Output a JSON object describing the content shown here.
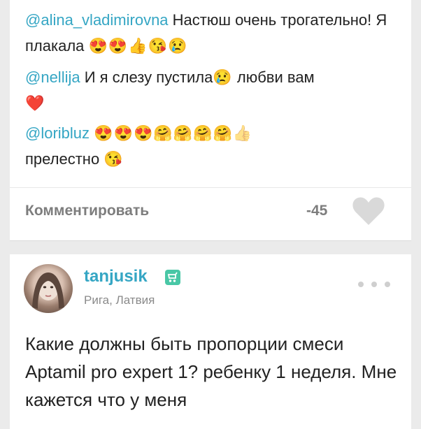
{
  "comments": [
    {
      "user": "@alina_vladimirovna",
      "text": "Настюш  очень трогательно!  Я плакала",
      "emojis": "😍😍👍😘😢"
    },
    {
      "user": "@nellija",
      "text": "И я слезу пустила",
      "emoji_inline": "😢",
      "text_after": "любви вам",
      "emojis": "❤️"
    },
    {
      "user": "@loribluz",
      "emojis": "😍😍😍🤗🤗🤗🤗",
      "emoji_end": "👍",
      "text": "прелестно",
      "emoji_tail": "😘"
    }
  ],
  "actions": {
    "comment_label": "Комментировать",
    "likes_count": "-45"
  },
  "post": {
    "username": "tanjusik",
    "location": "Рига, Латвия",
    "text": "Какие должны быть пропорции смеси Aptamil pro expert 1? ребенку 1 неделя. Мне кажется что у меня"
  },
  "colors": {
    "accent": "#35a6c4",
    "badge": "#49c7a6",
    "heart": "#d9d9d9",
    "background": "#ebebeb"
  },
  "icons": [
    "heart-icon",
    "baby-stroller-icon",
    "more-dots-icon"
  ]
}
